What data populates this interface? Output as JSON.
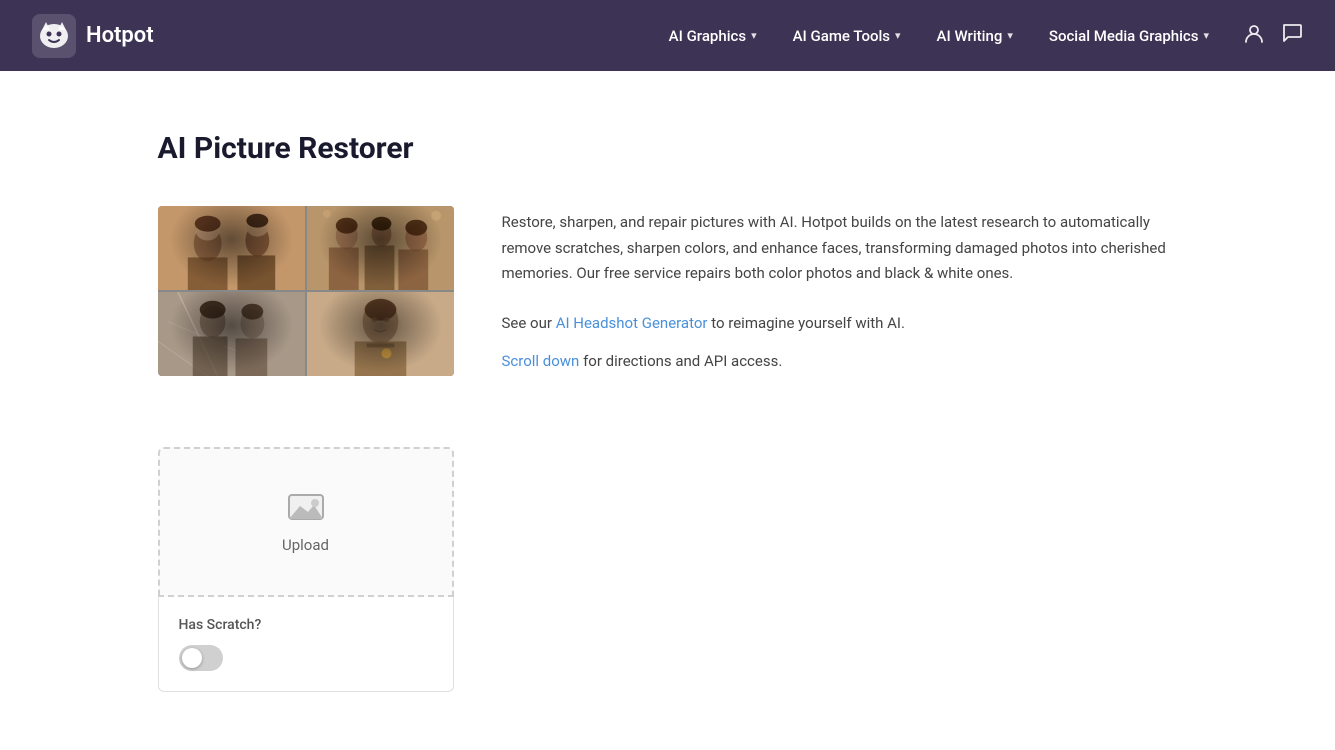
{
  "brand": {
    "logo_alt": "Hotpot logo",
    "title": "Hotpot"
  },
  "nav": {
    "items": [
      {
        "label": "AI Graphics",
        "has_dropdown": true
      },
      {
        "label": "AI Game Tools",
        "has_dropdown": true
      },
      {
        "label": "AI Writing",
        "has_dropdown": true
      },
      {
        "label": "Social Media Graphics",
        "has_dropdown": true
      }
    ],
    "user_icon": "👤",
    "chat_icon": "💬"
  },
  "page": {
    "title": "AI Picture Restorer",
    "description": "Restore, sharpen, and repair pictures with AI. Hotpot builds on the latest research to automatically remove scratches, sharpen colors, and enhance faces, transforming damaged photos into cherished memories. Our free service repairs both color photos and black & white ones.",
    "see_our_text": "See our",
    "headshot_link_label": "AI Headshot Generator",
    "reimagine_text": "to reimagine yourself with AI.",
    "scroll_link_label": "Scroll down",
    "scroll_suffix": "for directions and API access.",
    "upload_label": "Upload",
    "has_scratch_label": "Has Scratch?",
    "toggle_state": false
  }
}
